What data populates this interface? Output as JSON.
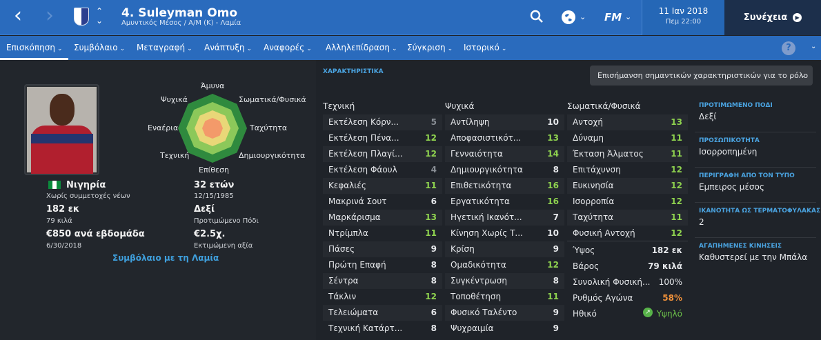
{
  "header": {
    "player_name": "4. Suleyman Omo",
    "player_subtitle": "Αμυντικός Μέσος / Α/Μ (Κ) - Λαμία",
    "date": "11 Ιαν 2018",
    "time": "Πεμ 22:00",
    "continue_label": "Συνέχεια",
    "fm_label": "FM"
  },
  "tabs": [
    {
      "label": "Επισκόπηση",
      "active": true
    },
    {
      "label": "Συμβόλαιο"
    },
    {
      "label": "Μεταγραφή"
    },
    {
      "label": "Ανάπτυξη"
    },
    {
      "label": "Αναφορές"
    },
    {
      "label": "Αλληλεπίδραση"
    },
    {
      "label": "Σύγκριση"
    },
    {
      "label": "Ιστορικό"
    }
  ],
  "help_label": "?",
  "profile": {
    "nationality": "Νιγηρία",
    "youth_caps": "Χωρίς συμμετοχές νέων",
    "height": "182 εκ",
    "weight": "79 κιλά",
    "wage": "€850 ανά εβδομάδα",
    "contract_end": "6/30/2018",
    "age": "32 ετών",
    "dob": "12/15/1985",
    "preferred_foot": "Δεξί",
    "preferred_foot_label": "Προτιμώμενο Πόδι",
    "value": "€2.5χ.",
    "value_label": "Εκτιμώμενη αξία",
    "contract_link": "Συμβόλαιο με τη Λαμία"
  },
  "radar": {
    "labels": [
      "Άμυνα",
      "Σωματικά/Φυσικά",
      "Ταχύτητα",
      "Δημιουργικότητα",
      "Επίθεση",
      "Τεχνική",
      "Εναέρια",
      "Ψυχικά"
    ],
    "colors": {
      "outer": "#2f8a3e",
      "mid": "#8cc85a",
      "inner": "#e9d778",
      "core": "#f39a6a"
    }
  },
  "attributes": {
    "section_title": "ΧΑΡΑΚΤΗΡΙΣΤΙΚΑ",
    "role_dropdown": "Επισήμανση σημαντικών χαρακτηριστικών για το ρόλο",
    "technical": {
      "title": "Τεχνική",
      "items": [
        {
          "name": "Εκτέλεση Κόρν...",
          "value": "5"
        },
        {
          "name": "Εκτέλεση Πένα...",
          "value": "12"
        },
        {
          "name": "Εκτέλεση Πλαγί...",
          "value": "12"
        },
        {
          "name": "Εκτέλεση Φάουλ",
          "value": "4"
        },
        {
          "name": "Κεφαλιές",
          "value": "11"
        },
        {
          "name": "Μακρινά Σουτ",
          "value": "6"
        },
        {
          "name": "Μαρκάρισμα",
          "value": "13"
        },
        {
          "name": "Ντρίμπλα",
          "value": "11"
        },
        {
          "name": "Πάσες",
          "value": "9"
        },
        {
          "name": "Πρώτη Επαφή",
          "value": "8"
        },
        {
          "name": "Σέντρα",
          "value": "8"
        },
        {
          "name": "Τάκλιν",
          "value": "12"
        },
        {
          "name": "Τελειώματα",
          "value": "6"
        },
        {
          "name": "Τεχνική Κατάρτ...",
          "value": "8"
        }
      ]
    },
    "mental": {
      "title": "Ψυχικά",
      "items": [
        {
          "name": "Αντίληψη",
          "value": "10"
        },
        {
          "name": "Αποφασιστικότ...",
          "value": "13"
        },
        {
          "name": "Γενναιότητα",
          "value": "14"
        },
        {
          "name": "Δημιουργικότητα",
          "value": "8"
        },
        {
          "name": "Επιθετικότητα",
          "value": "16"
        },
        {
          "name": "Εργατικότητα",
          "value": "16"
        },
        {
          "name": "Ηγετική Ικανότ...",
          "value": "7"
        },
        {
          "name": "Κίνηση Χωρίς Τ...",
          "value": "10"
        },
        {
          "name": "Κρίση",
          "value": "9"
        },
        {
          "name": "Ομαδικότητα",
          "value": "12"
        },
        {
          "name": "Συγκέντρωση",
          "value": "8"
        },
        {
          "name": "Τοποθέτηση",
          "value": "11"
        },
        {
          "name": "Φυσικό Ταλέντο",
          "value": "9"
        },
        {
          "name": "Ψυχραιμία",
          "value": "9"
        }
      ]
    },
    "physical": {
      "title": "Σωματικά/Φυσικά",
      "items": [
        {
          "name": "Αντοχή",
          "value": "13"
        },
        {
          "name": "Δύναμη",
          "value": "11"
        },
        {
          "name": "Έκταση Άλματος",
          "value": "11"
        },
        {
          "name": "Επιτάχυνση",
          "value": "12"
        },
        {
          "name": "Ευκινησία",
          "value": "12"
        },
        {
          "name": "Ισορροπία",
          "value": "12"
        },
        {
          "name": "Ταχύτητα",
          "value": "11"
        },
        {
          "name": "Φυσική Αντοχή",
          "value": "12"
        }
      ]
    },
    "info": [
      {
        "name": "Ύψος",
        "value": "182 εκ"
      },
      {
        "name": "Βάρος",
        "value": "79 κιλά"
      },
      {
        "name": "Συνολική Φυσική...",
        "value": "100%"
      },
      {
        "name": "Ρυθμός Αγώνα",
        "value": "58%"
      },
      {
        "name": "Ηθικό",
        "value": "Υψηλό"
      }
    ]
  },
  "right_panel": [
    {
      "heading": "ΠΡΟΤΙΜΩΜΕΝΟ ΠΟΔΙ",
      "value": "Δεξί"
    },
    {
      "heading": "ΠΡΟΣΩΠΙΚΟΤΗΤΑ",
      "value": "Ισορροπημένη"
    },
    {
      "heading": "ΠΕΡΙΓΡΑΦΗ ΑΠΟ ΤΟΝ ΤΥΠΟ",
      "value": "Εμπειρος μέσος"
    },
    {
      "heading": "ΙΚΑΝΟΤΗΤΑ ΩΣ ΤΕΡΜΑΤΟΦΥΛΑΚΑΣ",
      "value": "2"
    },
    {
      "heading": "ΑΓΑΠΗΜΕΝΕΣ ΚΙΝΗΣΕΙΣ",
      "value": "Καθυστερεί με την Μπάλα"
    }
  ],
  "value_colors": {
    "high": "#8fd34f",
    "mid": "#e6e8eb",
    "low": "#8a8f96",
    "warn": "#f0913a",
    "good": "#6cc24a"
  }
}
